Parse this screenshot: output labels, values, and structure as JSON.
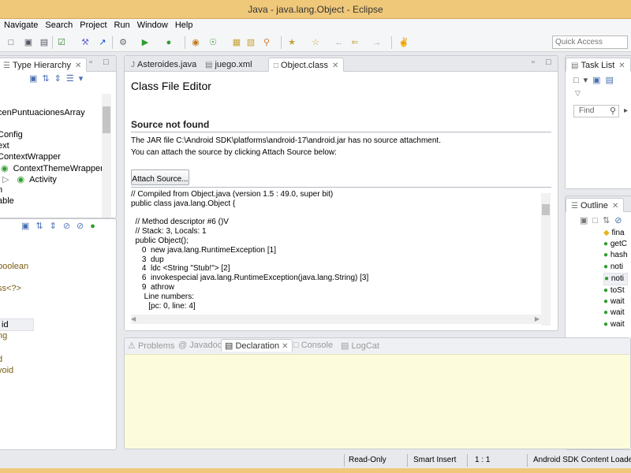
{
  "window": {
    "title": "Java - java.lang.Object - Eclipse"
  },
  "menu": [
    "Navigate",
    "Search",
    "Project",
    "Run",
    "Window",
    "Help"
  ],
  "toolbar": {
    "quick_access_placeholder": "Quick Access"
  },
  "type_hierarchy": {
    "tab_label": "Type Hierarchy",
    "tree": [
      "cenPuntuacionesArray",
      "Config",
      "ext",
      "ContextWrapper",
      "ContextThemeWrapper",
      "Activity",
      "n",
      "able"
    ],
    "members": [
      " boolean",
      "ss<?>",
      "t",
      "id",
      "ng",
      "d",
      " void"
    ]
  },
  "editor": {
    "tabs": [
      "Asteroides.java",
      "juego.xml",
      "Object.class"
    ],
    "heading": "Class File Editor",
    "source_not_found": "Source not found",
    "jar_message": "The JAR file C:\\Android SDK\\platforms\\android-17\\android.jar has no source attachment.",
    "attach_message": "You can attach the source by clicking Attach Source below:",
    "attach_button": "Attach Source...",
    "code": "// Compiled from Object.java (version 1.5 : 49.0, super bit)\npublic class java.lang.Object {\n\n  // Method descriptor #6 ()V\n  // Stack: 3, Locals: 1\n  public Object();\n     0  new java.lang.RuntimeException [1]\n     3  dup\n     4  ldc <String \"Stub!\"> [2]\n     6  invokespecial java.lang.RuntimeException(java.lang.String) [3]\n     9  athrow\n      Line numbers:\n        [pc: 0, line: 4]"
  },
  "task_list": {
    "tab_label": "Task List",
    "find_placeholder": "Find"
  },
  "outline": {
    "tab_label": "Outline",
    "items": [
      "fina",
      "getC",
      "hash",
      "noti",
      "noti",
      "toSt",
      "wait",
      "wait",
      "wait"
    ]
  },
  "bottom_tabs": [
    "Problems",
    "Javadoc",
    "Declaration",
    "Console",
    "LogCat"
  ],
  "status": {
    "mode": "Read-Only",
    "insert": "Smart Insert",
    "position": "1 : 1",
    "job": "Android SDK Content Loader"
  },
  "colors": {
    "title_bar": "#f0c87a",
    "declaration_bg": "#fcfcdc"
  }
}
